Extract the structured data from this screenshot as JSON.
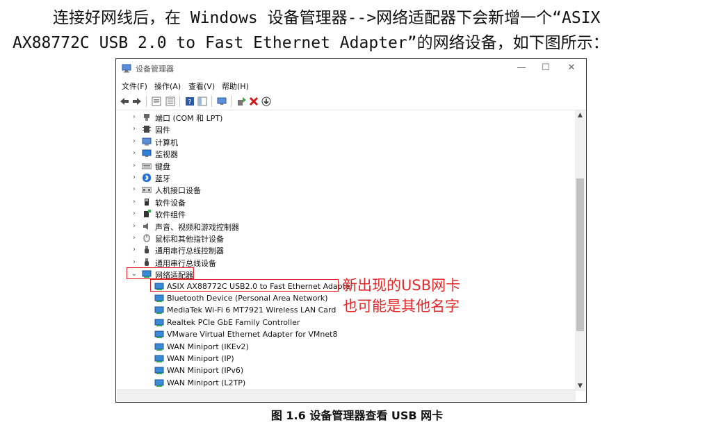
{
  "intro": {
    "line1": "连接好网线后，在 Windows 设备管理器-->网络适配器下会新增一个“ASIX",
    "line2": "AX88772C USB 2.0 to Fast Ethernet Adapter”的网络设备，如下图所示："
  },
  "window": {
    "title": "设备管理器",
    "controls": {
      "minimize": "—",
      "maximize": "☐",
      "close": "✕"
    },
    "menu": [
      "文件(F)",
      "操作(A)",
      "查看(V)",
      "帮助(H)"
    ],
    "categories": [
      {
        "label": "端口 (COM 和 LPT)",
        "icon": "port-icon",
        "expanded": false
      },
      {
        "label": "固件",
        "icon": "firmware-icon",
        "expanded": false
      },
      {
        "label": "计算机",
        "icon": "computer-icon",
        "expanded": false
      },
      {
        "label": "监视器",
        "icon": "monitor-icon",
        "expanded": false
      },
      {
        "label": "键盘",
        "icon": "keyboard-icon",
        "expanded": false
      },
      {
        "label": "蓝牙",
        "icon": "bluetooth-icon",
        "expanded": false
      },
      {
        "label": "人机接口设备",
        "icon": "hid-icon",
        "expanded": false
      },
      {
        "label": "软件设备",
        "icon": "software-device-icon",
        "expanded": false
      },
      {
        "label": "软件组件",
        "icon": "software-component-icon",
        "expanded": false
      },
      {
        "label": "声音、视频和游戏控制器",
        "icon": "sound-icon",
        "expanded": false
      },
      {
        "label": "鼠标和其他指针设备",
        "icon": "mouse-icon",
        "expanded": false
      },
      {
        "label": "通用串行总线控制器",
        "icon": "usb-icon",
        "expanded": false
      },
      {
        "label": "通用串行总线设备",
        "icon": "usb-icon",
        "expanded": false
      },
      {
        "label": "网络适配器",
        "icon": "network-adapter-icon",
        "expanded": true
      }
    ],
    "adapters": [
      "ASIX AX88772C USB2.0 to Fast Ethernet Adapter",
      "Bluetooth Device (Personal Area Network)",
      "MediaTek Wi-Fi 6 MT7921 Wireless LAN Card",
      "Realtek PCIe GbE Family Controller",
      "VMware Virtual Ethernet Adapter for VMnet8",
      "WAN Miniport (IKEv2)",
      "WAN Miniport (IP)",
      "WAN Miniport (IPv6)",
      "WAN Miniport (L2TP)"
    ]
  },
  "annotation": {
    "line1": "新出现的USB网卡",
    "line2": "也可能是其他名字",
    "color": "#e32a2a"
  },
  "caption": "图 1.6 设备管理器查看 USB 网卡"
}
